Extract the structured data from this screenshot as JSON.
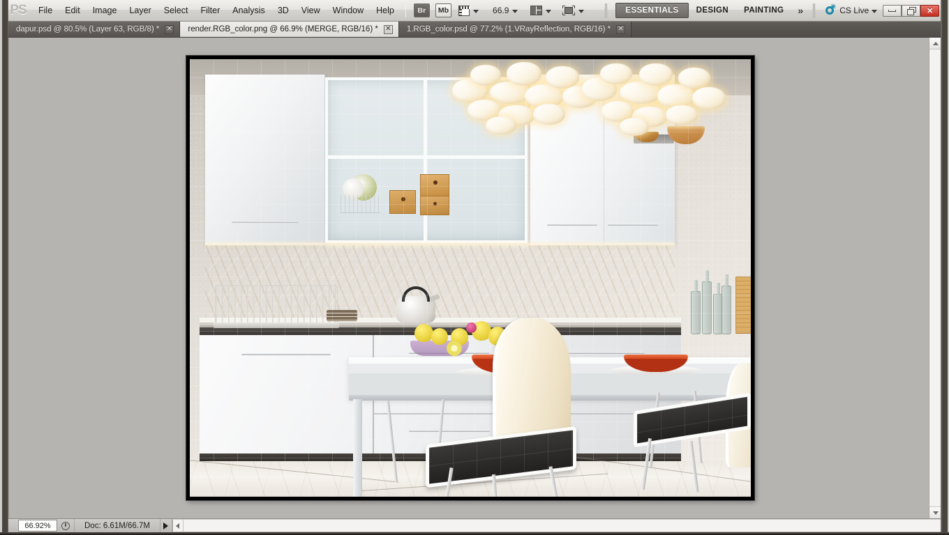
{
  "app": {
    "name": "Adobe Photoshop",
    "logo_text": "PS"
  },
  "menubar": {
    "items": [
      {
        "label": "File"
      },
      {
        "label": "Edit"
      },
      {
        "label": "Image"
      },
      {
        "label": "Layer"
      },
      {
        "label": "Select"
      },
      {
        "label": "Filter"
      },
      {
        "label": "Analysis"
      },
      {
        "label": "3D"
      },
      {
        "label": "View"
      },
      {
        "label": "Window"
      },
      {
        "label": "Help"
      }
    ],
    "bridge_button": "Br",
    "mini_bridge_button": "Mb",
    "view_extras_icon": "view-extras-icon",
    "zoom_level": "66.9",
    "arrange_documents_icon": "arrange-documents-icon",
    "screen_mode_icon": "screen-mode-icon"
  },
  "workspaces": {
    "tabs": [
      {
        "label": "ESSENTIALS",
        "active": true
      },
      {
        "label": "DESIGN",
        "active": false
      },
      {
        "label": "PAINTING",
        "active": false
      }
    ],
    "more_label": "»"
  },
  "cs_live": {
    "label": "CS Live",
    "icon": "cs-live-icon",
    "caret": "▾",
    "accent_color": "#1b89a8"
  },
  "window_controls": {
    "minimize": "minimize-button",
    "restore": "restore-button",
    "close_label": "✕",
    "close_color": "#c32f20"
  },
  "document_tabs": [
    {
      "title": "dapur.psd @ 80.5% (Layer 63, RGB/8) *",
      "active": false,
      "close": "✕"
    },
    {
      "title": "render.RGB_color.png @ 66.9% (MERGE, RGB/16) *",
      "active": true,
      "close": "✕"
    },
    {
      "title": "1.RGB_color.psd @ 77.2% (1.VRayReflection, RGB/16) *",
      "active": false,
      "close": "✕"
    }
  ],
  "canvas": {
    "document_name": "render.RGB_color.png",
    "content_description": "Rendered modern white kitchen interior with dining table, chairs, pendant lamps and marble backsplash"
  },
  "statusbar": {
    "zoom_value": "66.92%",
    "timing_icon": "timing-icon",
    "doc_info": "Doc: 6.61M/66.7M",
    "menu_arrow": "status-menu-arrow"
  },
  "scrollbars": {
    "vertical_up": "scroll-up-arrow",
    "vertical_down": "scroll-down-arrow",
    "horizontal_left": "scroll-left-arrow"
  },
  "theme": {
    "chrome_light": "#d6d4d0",
    "tabbar_dark": "#575450",
    "workarea_gray": "#b6b4b0"
  }
}
